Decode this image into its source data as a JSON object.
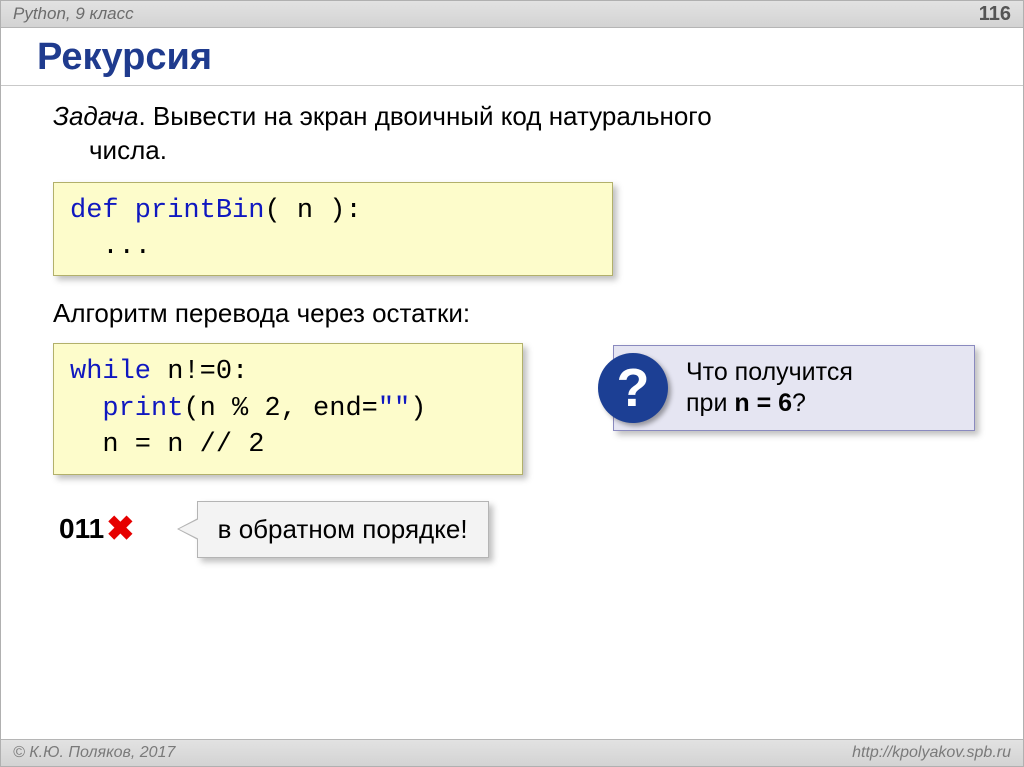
{
  "header": {
    "course": "Python, 9 класс",
    "page": "116"
  },
  "title": "Рекурсия",
  "task": {
    "label": "Задача",
    "text1": ". Вывести на экран двоичный код натурального",
    "text2": "числа."
  },
  "code1": {
    "line1_kw": "def",
    "line1_fn": " printBin",
    "line1_rest": "( n ):",
    "line2": "  ..."
  },
  "subheading": "Алгоритм перевода через остатки:",
  "code2": {
    "line1_kw": "while",
    "line1_rest": " n!=0:",
    "line2_pre": "  ",
    "line2_fn": "print",
    "line2_mid": "(n % 2, end=",
    "line2_str": "\"\"",
    "line2_end": ")",
    "line3": "  n = n // 2"
  },
  "question": {
    "badge": "?",
    "line1": "Что получится",
    "line2_a": "при ",
    "line2_b": "n = 6",
    "line2_c": "?"
  },
  "result": {
    "value": "011",
    "callout": "в обратном порядке!"
  },
  "footer": {
    "copyright": "© К.Ю. Поляков, 2017",
    "url": "http://kpolyakov.spb.ru"
  }
}
